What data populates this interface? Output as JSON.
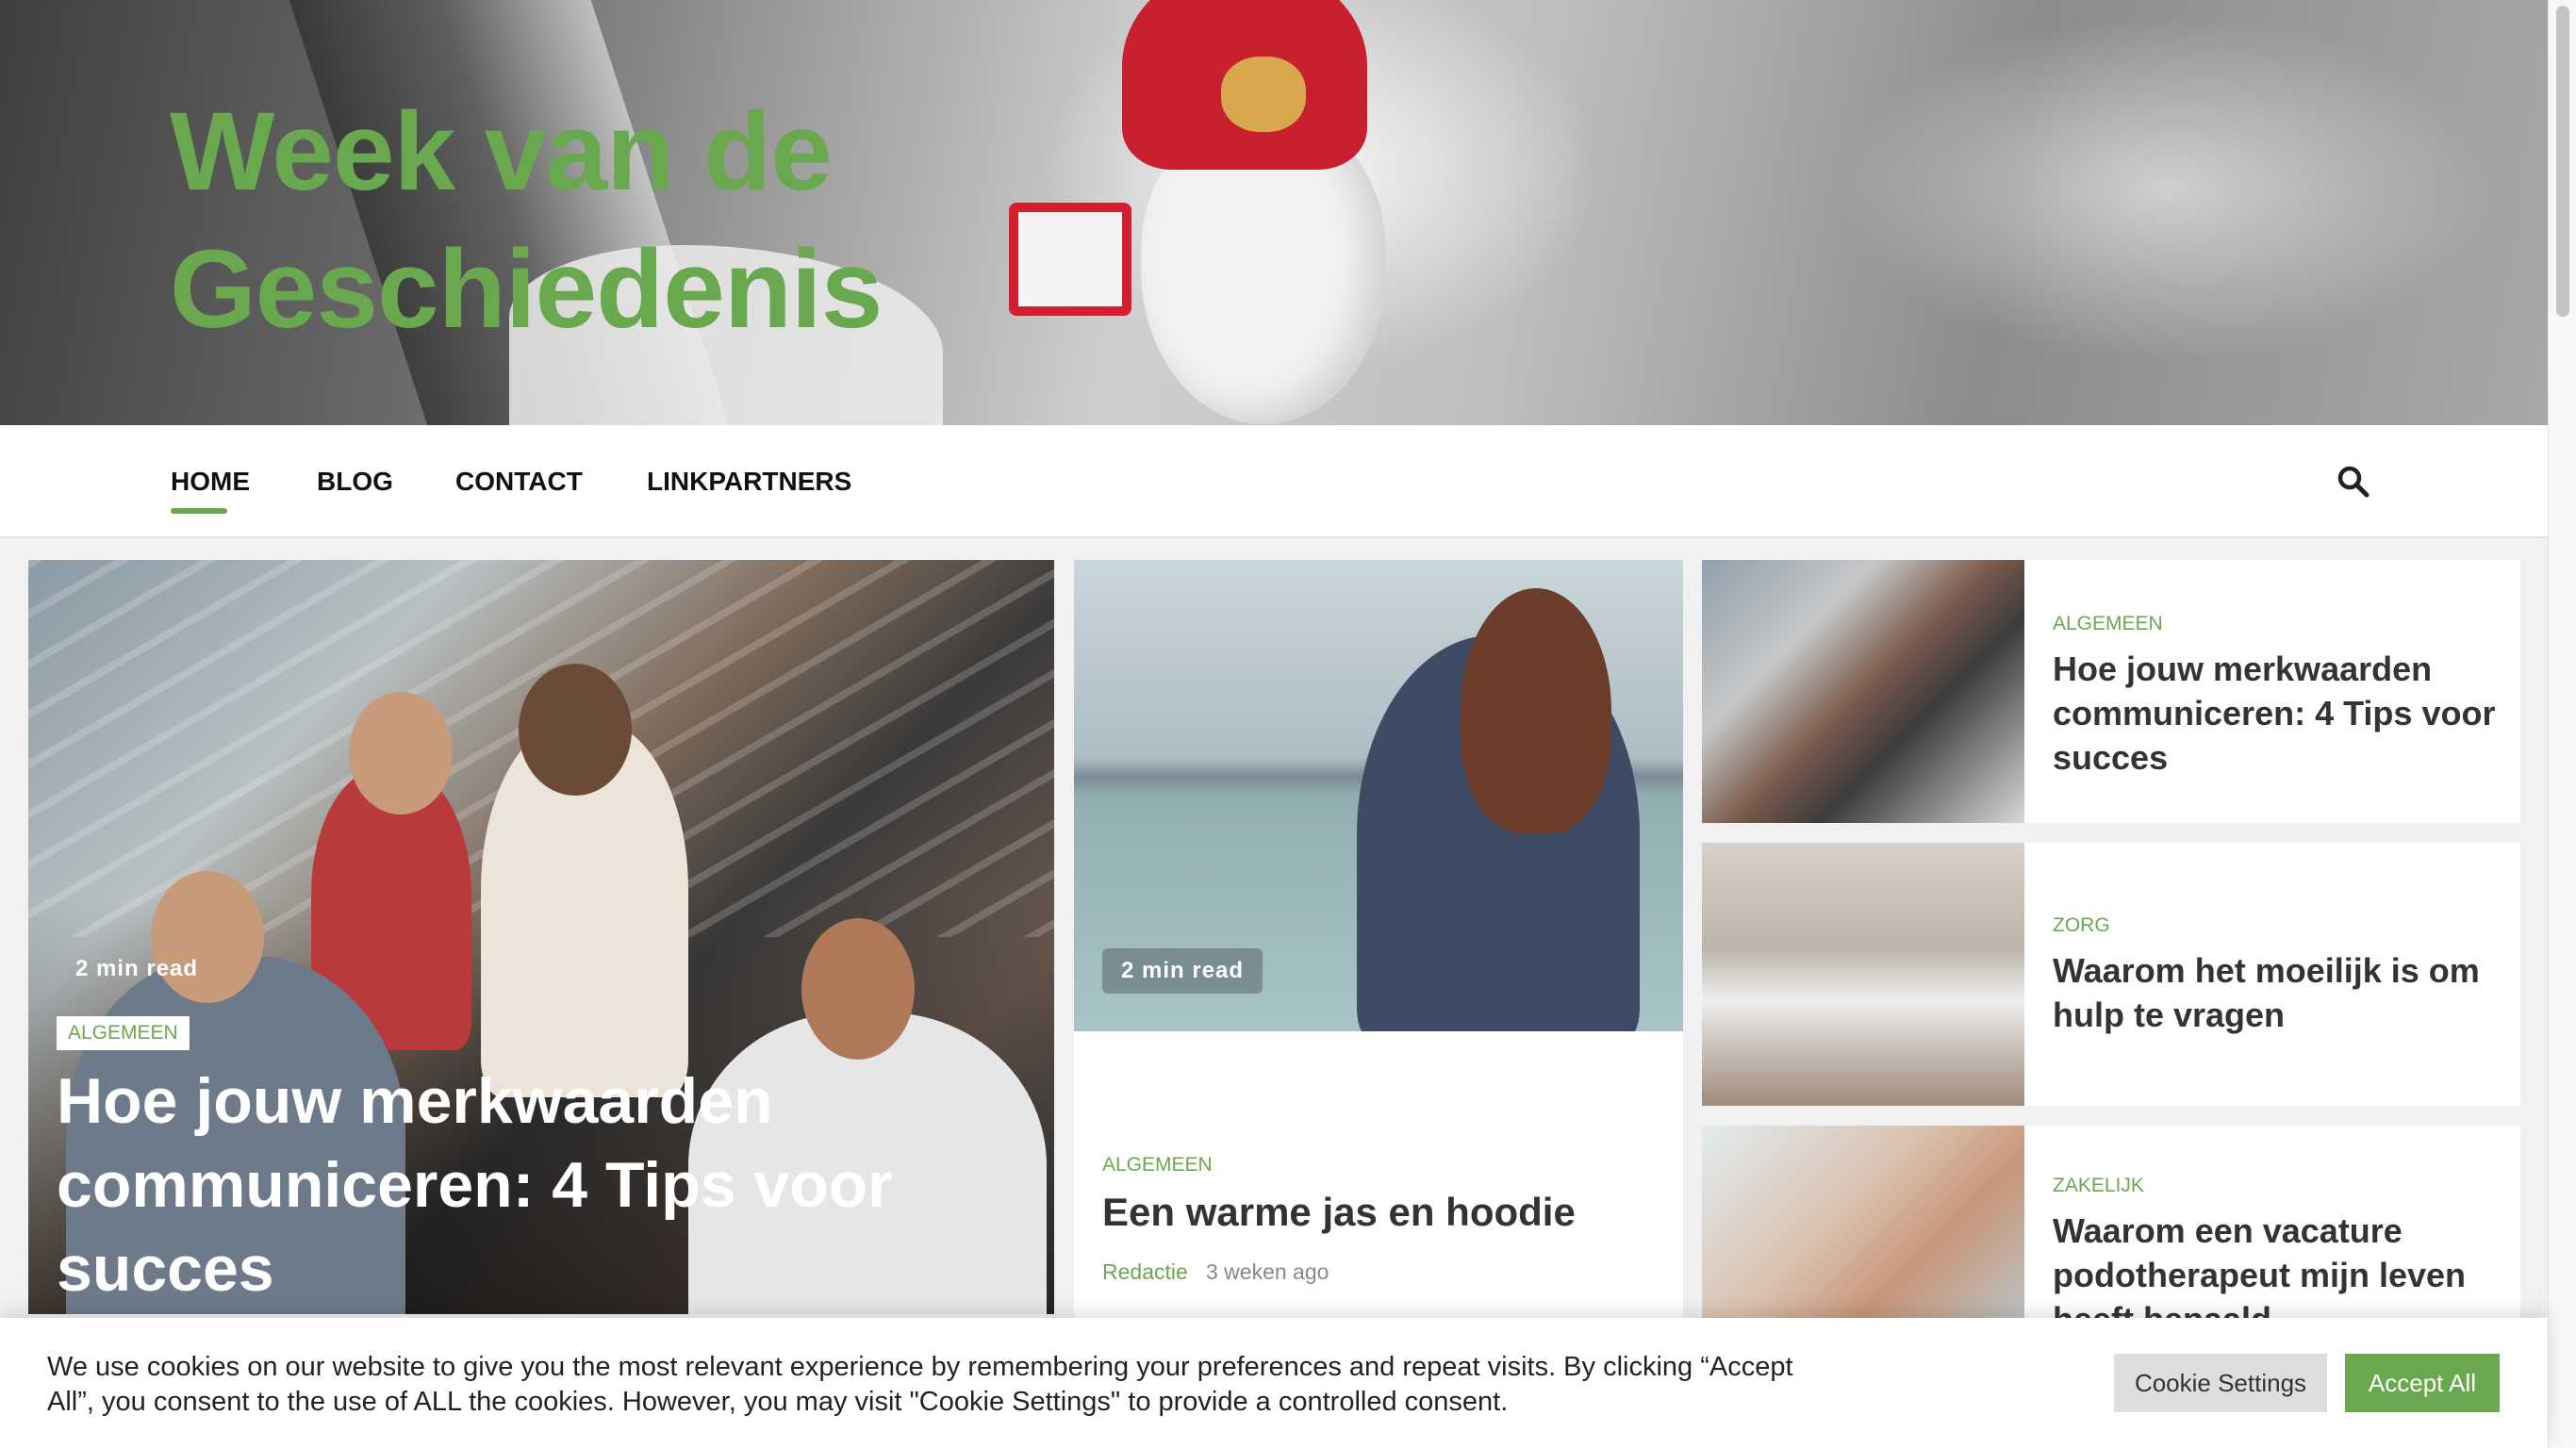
{
  "site": {
    "title_line1": "Week van de",
    "title_line2": "Geschiedenis"
  },
  "nav": {
    "items": [
      {
        "label": "HOME",
        "active": true
      },
      {
        "label": "BLOG"
      },
      {
        "label": "CONTACT"
      },
      {
        "label": "LINKPARTNERS"
      }
    ],
    "search_icon": "search-icon"
  },
  "feature": {
    "read_time": "2 min read",
    "category": "ALGEMEEN",
    "title": "Hoe jouw merkwaarden communiceren: 4 Tips voor succes"
  },
  "middle": {
    "read_time": "2 min read",
    "category": "ALGEMEEN",
    "title": "Een warme jas en hoodie",
    "author": "Redactie",
    "date": "3 weken ago"
  },
  "list": [
    {
      "category": "ALGEMEEN",
      "title": "Hoe jouw merkwaarden communiceren: 4 Tips voor succes"
    },
    {
      "category": "ZORG",
      "title": "Waarom het moeilijk is om hulp te vragen"
    },
    {
      "category": "ZAKELIJK",
      "title": "Waarom een vacature podotherapeut mijn leven heeft bepaald"
    }
  ],
  "cookie": {
    "text": "We use cookies on our website to give you the most relevant experience by remembering your preferences and repeat visits. By clicking “Accept All”, you consent to the use of ALL the cookies. However, you may visit \"Cookie Settings\" to provide a controlled consent.",
    "settings_label": "Cookie Settings",
    "accept_label": "Accept All"
  },
  "colors": {
    "accent": "#6aa84f",
    "text": "#333333"
  }
}
